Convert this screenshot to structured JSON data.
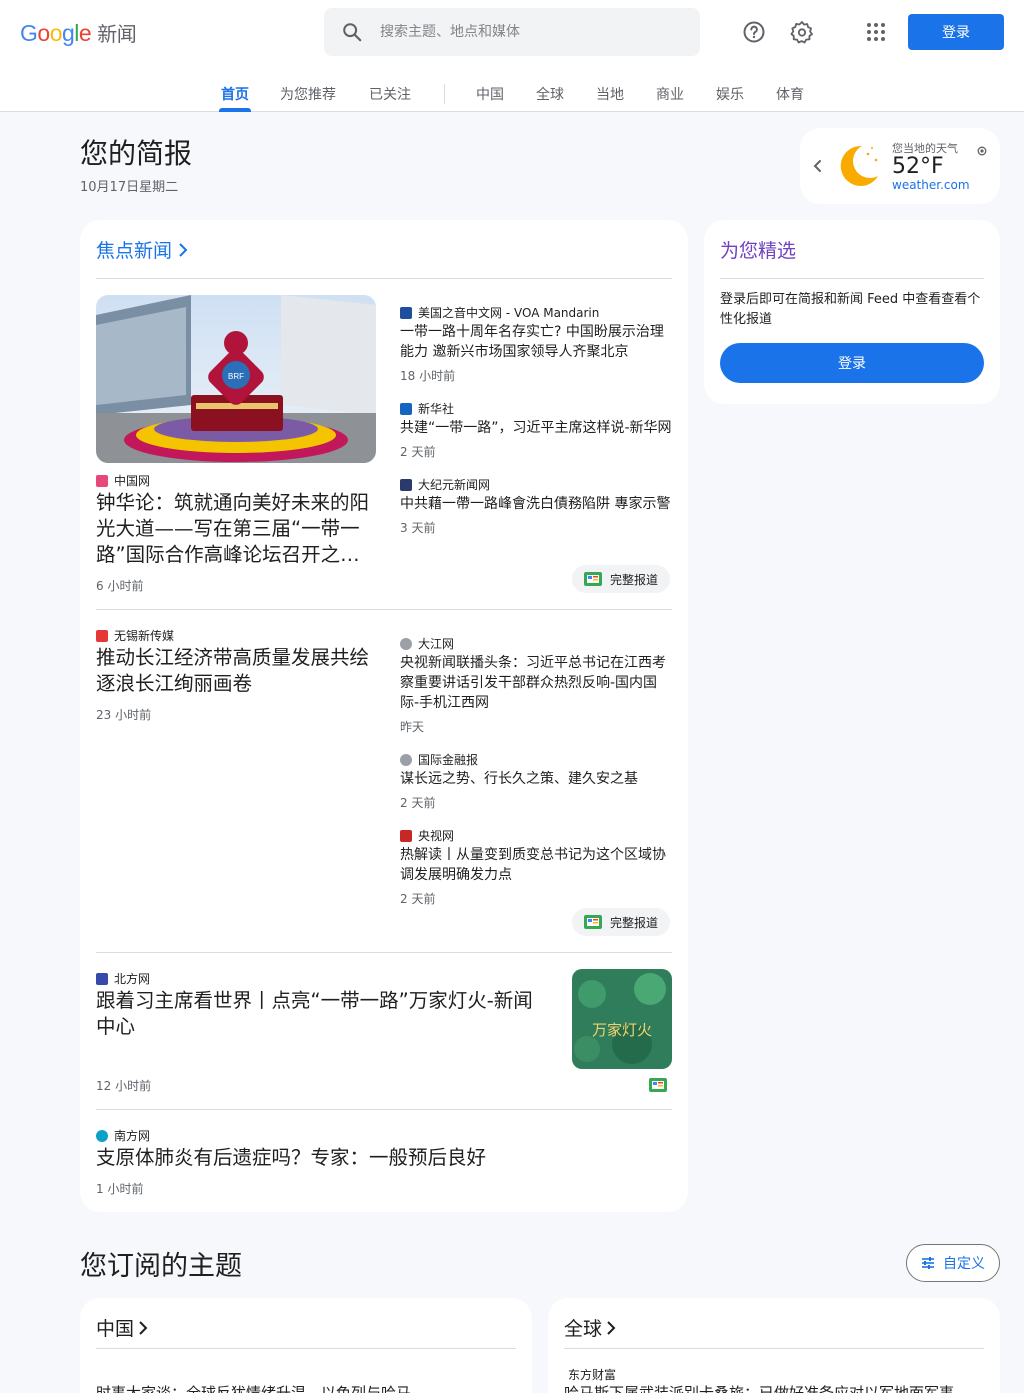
{
  "header": {
    "logo_text": "Google",
    "product_name": "新闻",
    "search_placeholder": "搜索主题、地点和媒体",
    "login_label": "登录"
  },
  "tabs": [
    "首页",
    "为您推荐",
    "已关注",
    "中国",
    "全球",
    "当地",
    "商业",
    "娱乐",
    "体育"
  ],
  "briefing": {
    "title": "您的简报",
    "date": "10月17日星期二"
  },
  "weather": {
    "label": "您当地的天气",
    "temp": "52°F",
    "source": "weather.com"
  },
  "headlines": {
    "section_label": "焦点新闻",
    "full_coverage_label": "完整报道",
    "cluster1": {
      "main": {
        "source": "中国网",
        "title": "钟华论：筑就通向美好未来的阳光大道——写在第三届“一带一路”国际合作高峰论坛召开之…",
        "time": "6 小时前"
      },
      "side": [
        {
          "source": "美国之音中文网 - VOA Mandarin",
          "title": "一带一路十周年名存实亡? 中国盼展示治理能力 邀新兴市场国家领导人齐聚北京",
          "time": "18 小时前"
        },
        {
          "source": "新华社",
          "title": "共建“一带一路”，习近平主席这样说-新华网",
          "time": "2 天前"
        },
        {
          "source": "大纪元新闻网",
          "title": "中共藉一帶一路峰會洗白債務陷阱 專家示警",
          "time": "3 天前"
        }
      ]
    },
    "cluster2": {
      "main": {
        "source": "无锡新传媒",
        "title": "推动长江经济带高质量发展共绘逐浪长江绚丽画卷",
        "time": "23 小时前"
      },
      "side": [
        {
          "source": "大江网",
          "title": "央视新闻联播头条：习近平总书记在江西考察重要讲话引发干部群众热烈反响-国内国际-手机江西网",
          "time": "昨天"
        },
        {
          "source": "国际金融报",
          "title": "谋长远之势、行长久之策、建久安之基",
          "time": "2 天前"
        },
        {
          "source": "央视网",
          "title": "热解读丨从量变到质变总书记为这个区域协调发展明确发力点",
          "time": "2 天前"
        }
      ]
    },
    "story3": {
      "source": "北方网",
      "title": "跟着习主席看世界丨点亮“一带一路”万家灯火-新闻中心",
      "time": "12 小时前",
      "thumb_text": "万家灯火"
    },
    "story4": {
      "source": "南方网",
      "title": "支原体肺炎有后遗症吗？专家：一般预后良好",
      "time": "1 小时前"
    }
  },
  "picks": {
    "title": "为您精选",
    "description": "登录后即可在简报和新闻 Feed 中查看查看个性化报道",
    "button": "登录"
  },
  "topics": {
    "title": "您订阅的主题",
    "customize_label": "自定义",
    "cards": [
      {
        "name": "中国",
        "preview": "时事大家谈：全球反犹情绪升温，以色列与哈马"
      },
      {
        "name": "全球",
        "source": "东方财富",
        "preview": "哈马斯下属武装派别卡桑旅：已做好准备应对以军地面军事"
      }
    ]
  },
  "colors": {
    "accent": "#1a73e8",
    "picks_title": "#6f42c1",
    "background": "#f6f8fc"
  }
}
